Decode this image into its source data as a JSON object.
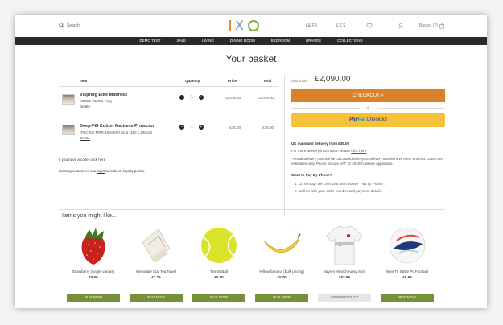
{
  "header": {
    "search_label": "Search",
    "currency_gbp": "£& FR",
    "currency_switch": "£ € $",
    "basket_label": "Basket (2)"
  },
  "nav": [
    "DEMO TEST",
    "SALE",
    "LIVING",
    "DINING ROOM",
    "BEDROOM",
    "BRANDS",
    "COLLECTIONS"
  ],
  "page_title": "Your basket",
  "table": {
    "headers": {
      "item": "Item",
      "quantity": "Quantity",
      "price": "Price",
      "total": "Total"
    },
    "rows": [
      {
        "name": "Vispring Elite Mattress",
        "code": "(39055-90838) King",
        "delete": "Delete",
        "qty": "1",
        "price": "£2,015.00",
        "total": "£2,015.00"
      },
      {
        "name": "Deep-Fill Cotton Mattress Protector",
        "code": "(PBC001-MPR-150x200) King (150 x 200cm)",
        "delete": "Delete",
        "qty": "1",
        "price": "£75.00",
        "total": "£75.00"
      }
    ]
  },
  "voucher": {
    "prefix": "If you have a code, ",
    "link": "click here"
  },
  "loyalty": {
    "prefix": "Existing customers can ",
    "link": "login",
    "suffix": " to redeem loyalty points."
  },
  "summary": {
    "subtotal_label": "Sub Total*:",
    "subtotal_value": "£2,090.00",
    "checkout_label": "CHECKOUT »",
    "or_label": "or",
    "paypal_pay": "Pay",
    "paypal_pal": "Pal",
    "paypal_checkout": "Checkout"
  },
  "delivery": {
    "heading": "UK mainland delivery from £35.00",
    "more_info_prefix": "For more delivery information please ",
    "more_info_link": "click here",
    "note": "*Actual delivery cost will be calculated after your delivery details have been entered. Dates are estimates only. Prices include VAT @ 20.00% where applicable.",
    "phone_heading": "Want to Pay By Phone?",
    "steps": [
      "1. Go through the checkout and choose \"Pay by Phone\".",
      "2. Call us with your order number and payment details."
    ]
  },
  "recommendations": {
    "title": "Items you might like...",
    "items": [
      {
        "name": "Strawberry (single variant)",
        "price": "£8.00",
        "button": "BUY NOW",
        "icon": "strawberry-icon"
      },
      {
        "name": "Wensdale Dial Tea Towel",
        "price": "£3.75",
        "button": "BUY NOW",
        "icon": "tea-towel-icon"
      },
      {
        "name": "Tennis Ball",
        "price": "£0.50",
        "button": "BUY NOW",
        "icon": "tennis-ball-icon"
      },
      {
        "name": "Yellow banana (bulk pricing)",
        "price": "£0.70",
        "button": "BUY NOW",
        "icon": "banana-icon"
      },
      {
        "name": "Bayern Munich Away Shirt",
        "price": "£52.99",
        "button": "VIEW PRODUCT",
        "icon": "football-shirt-icon"
      },
      {
        "name": "Nike T9 Strike PL Football",
        "price": "£9.99",
        "button": "BUY NOW",
        "icon": "football-icon"
      }
    ]
  },
  "colors": {
    "accent": "#d9822b",
    "paypal": "#f6c23a",
    "buy_now": "#77913a",
    "nav": "#2a2a2a"
  }
}
